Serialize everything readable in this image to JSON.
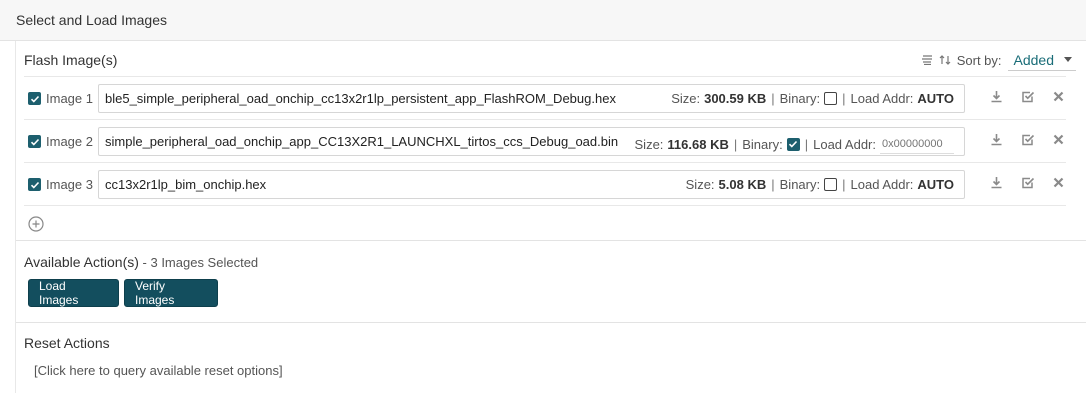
{
  "header": {
    "title": "Select and Load Images"
  },
  "flash": {
    "heading": "Flash Image(s)",
    "sort_label": "Sort by:",
    "sort_value": "Added"
  },
  "images": [
    {
      "label": "Image 1",
      "checked": true,
      "filename": "ble5_simple_peripheral_oad_onchip_cc13x2r1lp_persistent_app_FlashROM_Debug.hex",
      "size_label": "Size:",
      "size": "300.59 KB",
      "binary_label": "Binary:",
      "binary": false,
      "addr_label": "Load Addr:",
      "addr": "AUTO"
    },
    {
      "label": "Image 2",
      "checked": true,
      "filename": "simple_peripheral_oad_onchip_app_CC13X2R1_LAUNCHXL_tirtos_ccs_Debug_oad.bin",
      "size_label": "Size:",
      "size": "116.68 KB",
      "binary_label": "Binary:",
      "binary": true,
      "addr_label": "Load Addr:",
      "addr_placeholder": "0x00000000"
    },
    {
      "label": "Image 3",
      "checked": true,
      "filename": "cc13x2r1lp_bim_onchip.hex",
      "size_label": "Size:",
      "size": "5.08 KB",
      "binary_label": "Binary:",
      "binary": false,
      "addr_label": "Load Addr:",
      "addr": "AUTO"
    }
  ],
  "available": {
    "heading": "Available Action(s)",
    "subtitle": " - 3 Images Selected",
    "load_button": "Load Images",
    "verify_button": "Verify Images"
  },
  "reset": {
    "heading": "Reset Actions",
    "link": "[Click here to query available reset options]"
  },
  "colors": {
    "accent": "#1a6d78",
    "button": "#134e5e",
    "checkbox": "#1d5f6e"
  },
  "icons": [
    "list-icon",
    "sort-icon",
    "download-icon",
    "verify-icon",
    "delete-icon",
    "add-circle-icon",
    "check-icon"
  ]
}
